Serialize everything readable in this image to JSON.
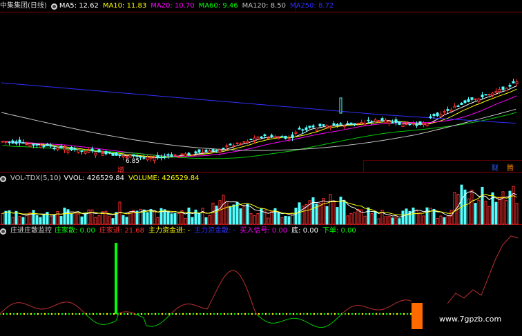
{
  "main_header": {
    "title": "中集集团(日线)",
    "indicators": [
      {
        "label": "MA5: 12.62",
        "color": "#ffffff"
      },
      {
        "label": "MA10: 11.83",
        "color": "#ffff00"
      },
      {
        "label": "MA20: 10.70",
        "color": "#ff00ff"
      },
      {
        "label": "MA60: 9.46",
        "color": "#00ff00"
      },
      {
        "label": "MA120: 8.50",
        "color": "#c0c0c0"
      },
      {
        "label": "MA250: 8.72",
        "color": "#3030ff"
      }
    ]
  },
  "price_labels": {
    "low": "6.85",
    "marker": "增"
  },
  "badges": {
    "left": "财",
    "right": "腾"
  },
  "vol_header": {
    "title": "VOL-TDX(5,10)",
    "items": [
      {
        "label": "VVOL: 426529.84",
        "color": "#ffffff"
      },
      {
        "label": "VOLUME: 426529.84",
        "color": "#ffff00"
      }
    ]
  },
  "ind_header": {
    "title": "庄进庄散监控",
    "items": [
      {
        "label": "庄家散: 0.00",
        "color": "#00ff00"
      },
      {
        "label": "庄家进: 21.68",
        "color": "#ff3030"
      },
      {
        "label": "主力资金进: -",
        "color": "#ffff00"
      },
      {
        "label": "主力资金散: -",
        "color": "#3030ff"
      },
      {
        "label": "买入信号: 0.00",
        "color": "#ff00ff"
      },
      {
        "label": "底: 0.00",
        "color": "#ffffff"
      },
      {
        "label": "下单: 0.00",
        "color": "#00ff00"
      }
    ]
  },
  "watermark": "www.7gpzb.com",
  "colors": {
    "up": "#ff3030",
    "down": "#54ffff",
    "grid": "#8b0000"
  }
}
